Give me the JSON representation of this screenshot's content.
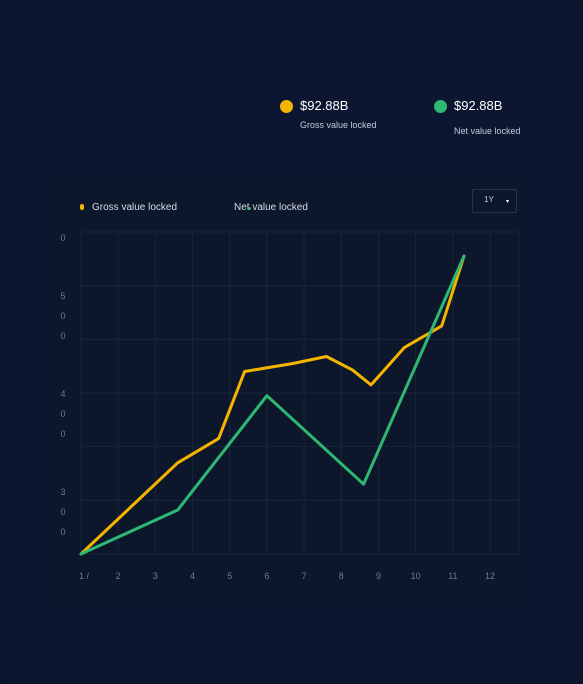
{
  "stats": [
    {
      "value": "$92.88B",
      "label": "Gross value locked",
      "color": "#f5b400"
    },
    {
      "value": "$92.88B",
      "label": "Net value locked",
      "color": "#2db873"
    }
  ],
  "range_select": {
    "value": "1Y",
    "caret": "▾"
  },
  "chart_data": {
    "type": "line",
    "x_tick_labels": [
      "1 /",
      "2",
      "3",
      "4",
      "5",
      "6",
      "7",
      "8",
      "9",
      "10",
      "11",
      "12"
    ],
    "y_tick_labels": [
      "0",
      "5",
      "0",
      "0",
      "4",
      "0",
      "0",
      "3",
      "0",
      "0"
    ],
    "x": [
      1,
      3.6,
      4.7,
      5.7,
      6.7,
      7.6,
      8.3,
      9.4,
      10.4,
      11.3,
      12.3
    ],
    "xlim": [
      1,
      12
    ],
    "ylim": [
      0,
      600
    ],
    "grid": true,
    "legend_position": "top-left",
    "series": [
      {
        "name": "Gross value locked",
        "color": "#f5b400",
        "points": [
          [
            1,
            0
          ],
          [
            3.6,
            170
          ],
          [
            4.7,
            215
          ],
          [
            5.4,
            340
          ],
          [
            6.7,
            355
          ],
          [
            7.6,
            368
          ],
          [
            8.3,
            343
          ],
          [
            8.8,
            315
          ],
          [
            9.7,
            385
          ],
          [
            10.7,
            425
          ],
          [
            11.3,
            555
          ]
        ]
      },
      {
        "name": "Net value locked",
        "color": "#2db873",
        "points": [
          [
            1,
            0
          ],
          [
            3.6,
            82
          ],
          [
            6.0,
            295
          ],
          [
            8.6,
            130
          ],
          [
            11.3,
            555
          ]
        ]
      }
    ]
  }
}
